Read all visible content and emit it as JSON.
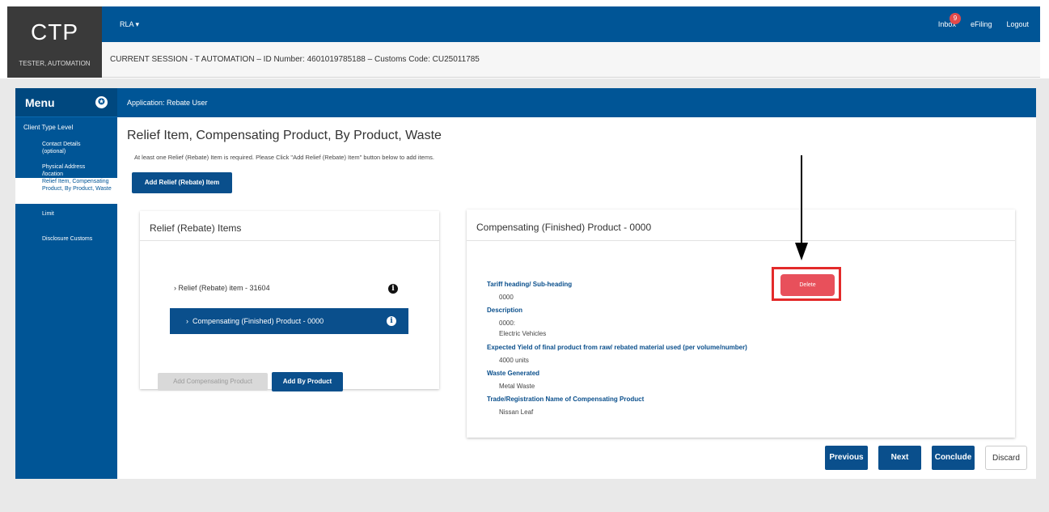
{
  "header": {
    "logo": "CTP",
    "user_name": "TESTER, AUTOMATION",
    "rla_menu": "RLA",
    "inbox_label": "Inbox",
    "inbox_count": "9",
    "efiling_label": "eFiling",
    "logout_label": "Logout",
    "session_text": "CURRENT SESSION - T AUTOMATION – ID Number: 4601019785188 – Customs Code: CU25011785"
  },
  "sidebar": {
    "title": "Menu",
    "client_type_level": "Client Type Level",
    "items": [
      {
        "label": "Contact Details (optional)"
      },
      {
        "label": "Physical Address /location"
      },
      {
        "label": "Relief Item, Compensating Product, By Product, Waste"
      },
      {
        "label": "Limit"
      },
      {
        "label": "Disclosure Customs"
      }
    ]
  },
  "main": {
    "application_label": "Application: Rebate User",
    "page_title": "Relief Item, Compensating Product, By Product, Waste",
    "hint": "At least one Relief (Rebate) Item is required. Please Click \"Add Relief (Rebate) Item\" button below to add items.",
    "add_relief_button": "Add Relief (Rebate) Item"
  },
  "relief_card": {
    "title": "Relief (Rebate) Items",
    "relief_item": "Relief (Rebate) item - 31604",
    "comp_product": "Compensating (Finished) Product - 0000",
    "add_comp_button": "Add Compensating Product",
    "add_by_button": "Add By Product"
  },
  "comp_card": {
    "title": "Compensating (Finished) Product - 0000",
    "delete_button": "Delete",
    "tariff_label": "Tariff heading/ Sub-heading",
    "tariff_value": "0000",
    "description_label": "Description",
    "description_value1": "0000:",
    "description_value2": "Electric Vehicles",
    "yield_label": "Expected Yield of final product from raw/ rebated material used (per volume/number)",
    "yield_value": "4000 units",
    "waste_label": "Waste Generated",
    "waste_value": "Metal Waste",
    "trade_label": "Trade/Registration Name of Compensating Product",
    "trade_value": "Nissan Leaf"
  },
  "footer_buttons": {
    "previous": "Previous",
    "next": "Next",
    "conclude": "Conclude",
    "discard": "Discard"
  },
  "colors": {
    "primary": "#005596",
    "button_dark": "#0a4f8c",
    "delete": "#e8505b",
    "highlight": "#e32a2a"
  }
}
